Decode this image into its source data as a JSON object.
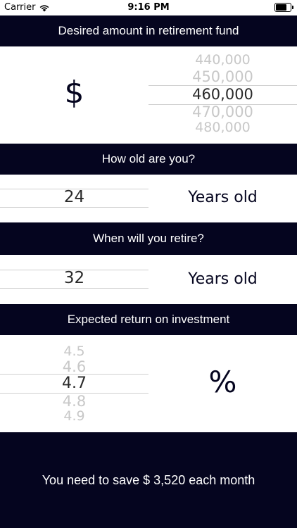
{
  "status_bar": {
    "carrier": "Carrier",
    "time": "9:16 PM",
    "battery_level": 0.75
  },
  "retirement_fund": {
    "header": "Desired amount in retirement fund",
    "currency_symbol": "$",
    "picker": {
      "above2": "440,000",
      "above1": "450,000",
      "selected": "460,000",
      "below1": "470,000",
      "below2": "480,000"
    }
  },
  "age": {
    "header": "How old are you?",
    "picker": {
      "selected": "24"
    },
    "unit": "Years old"
  },
  "retire_age": {
    "header": "When will you retire?",
    "picker": {
      "selected": "32"
    },
    "unit": "Years old"
  },
  "return": {
    "header": "Expected return on investment",
    "picker": {
      "above2": "4.5",
      "above1": "4.6",
      "selected": "4.7",
      "below1": "4.8",
      "below2": "4.9"
    },
    "unit": "%"
  },
  "result": {
    "text": "You need to save $ 3,520 each month"
  }
}
